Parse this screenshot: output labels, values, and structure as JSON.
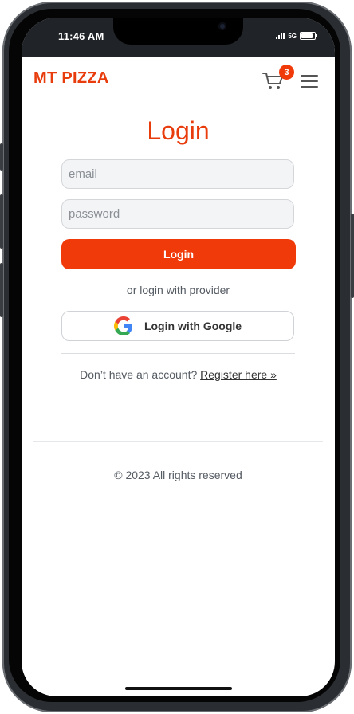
{
  "status_bar": {
    "time": "11:46 AM",
    "network": "5G"
  },
  "header": {
    "logo": "MT PIZZA",
    "cart_count": "3",
    "cart_icon": "cart-icon",
    "menu_icon": "hamburger-menu-icon"
  },
  "form": {
    "title": "Login",
    "email_placeholder": "email",
    "password_placeholder": "password",
    "login_button": "Login",
    "provider_text": "or login with provider",
    "google_button": "Login with Google",
    "register_prompt": "Don’t have an account?",
    "register_link": "Register here »"
  },
  "footer": {
    "text": "© 2023 All rights reserved"
  },
  "colors": {
    "brand": "#e83c0c",
    "button": "#f03a0a",
    "status_bar": "#202428"
  }
}
